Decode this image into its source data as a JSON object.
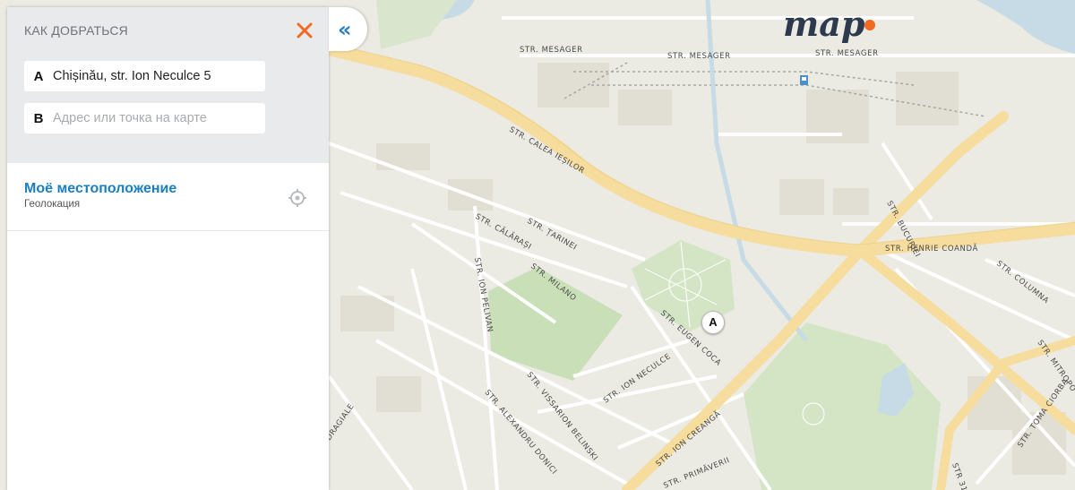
{
  "panel": {
    "title": "Как добраться",
    "close_label": "✕",
    "point_a": {
      "letter": "A",
      "value": "Chișinău, str. Ion Neculce 5"
    },
    "point_b": {
      "letter": "B",
      "placeholder": "Адрес или точка на карте"
    },
    "my_location": {
      "title": "Моё местоположение",
      "subtitle": "Геолокация"
    }
  },
  "collapse_label": "«",
  "logo_text": "map",
  "marker_label": "A",
  "street_labels": {
    "mesager1": "STR. MESAGER",
    "mesager2": "STR. MESAGER",
    "mesager3": "STR. MESAGER",
    "calea_iesilor": "STR. CALEA IEȘILOR",
    "tarinei": "STR. ȚARINEI",
    "calarasi": "STR. CĂLĂRAȘI",
    "milano": "STR. MILANO",
    "ion_pelivan": "STR. ION PELIVAN",
    "eugen_coca": "STR. EUGEN COCA",
    "ion_neculce": "STR. ION NECULCE",
    "vissarion": "STR. VISSARION BELINSKI",
    "alexandru_donici": "STR. ALEXANDRU DONICI",
    "ion_creanga": "STR. ION CREANGĂ",
    "primaverii": "STR. PRIMĂVERII",
    "bucuriei": "STR. BUCURIEI",
    "henrie_coanda": "STR. HENRIE COANDĂ",
    "columna": "STR. COLUMNA",
    "mitropolit": "STR. MITROPO",
    "toma_ciorba": "STR. TOMA CIORBA",
    "str31": "STR 31",
    "dragiale": "DRAGIALE"
  },
  "colors": {
    "accent": "#1a7fc1",
    "close": "#f26a21",
    "logo_dot": "#f26a21",
    "road_major": "#f6dd9e",
    "park": "#cfe2bf"
  }
}
